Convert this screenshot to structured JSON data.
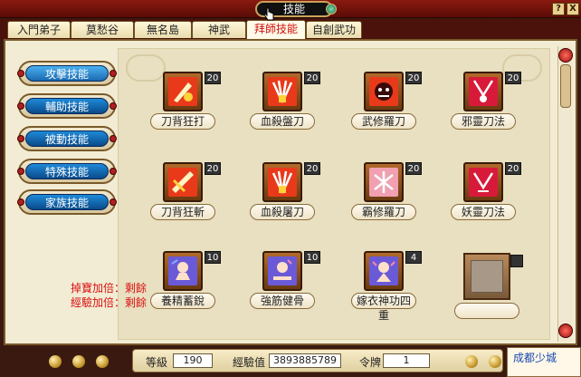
{
  "window": {
    "title": "技能",
    "help_button": "?",
    "close_button": "X"
  },
  "tabs": [
    {
      "label": "入門弟子"
    },
    {
      "label": "莫愁谷"
    },
    {
      "label": "無名島"
    },
    {
      "label": "神武"
    },
    {
      "label": "拜師技能",
      "active": true
    },
    {
      "label": "自創武功"
    }
  ],
  "categories": [
    {
      "label": "攻擊技能",
      "active": true
    },
    {
      "label": "輔助技能"
    },
    {
      "label": "被動技能"
    },
    {
      "label": "特殊技能"
    },
    {
      "label": "家族技能"
    }
  ],
  "skills": [
    {
      "name": "刀背狂打",
      "level": "20",
      "icon": "blade-strike-icon",
      "color": "#e83a1a"
    },
    {
      "name": "血殺盤刀",
      "level": "20",
      "icon": "blade-fan-icon",
      "color": "#e83a1a"
    },
    {
      "name": "武修羅刀",
      "level": "20",
      "icon": "asura-mask-icon",
      "color": "#e83a1a"
    },
    {
      "name": "邪靈刀法",
      "level": "20",
      "icon": "evil-spirit-icon",
      "color": "#d81a3a"
    },
    {
      "name": "刀背狂斬",
      "level": "20",
      "icon": "blade-slash-icon",
      "color": "#e83a1a"
    },
    {
      "name": "血殺屠刀",
      "level": "20",
      "icon": "blade-fan-icon",
      "color": "#e83a1a"
    },
    {
      "name": "霸修羅刀",
      "level": "20",
      "icon": "asura-blade-icon",
      "color": "#f0a0b0"
    },
    {
      "name": "妖靈刀法",
      "level": "20",
      "icon": "demon-spirit-icon",
      "color": "#d81a3a"
    },
    {
      "name": "養精蓄銳",
      "level": "10",
      "icon": "meditate-icon",
      "color": "#6a5ad8"
    },
    {
      "name": "強筋健骨",
      "level": "10",
      "icon": "strength-icon",
      "color": "#6a5ad8"
    },
    {
      "name": "嫁衣神功四重",
      "level": "4",
      "icon": "divine-art-icon",
      "color": "#6a5ad8"
    }
  ],
  "bonuses": [
    "掉寶加倍：剩餘",
    "經驗加倍：剩餘"
  ],
  "status": {
    "level_label": "等級",
    "level_value": "190",
    "exp_label": "經驗值",
    "exp_value": "3893885789",
    "token_label": "令牌",
    "token_value": "1"
  },
  "location": "成都少城"
}
